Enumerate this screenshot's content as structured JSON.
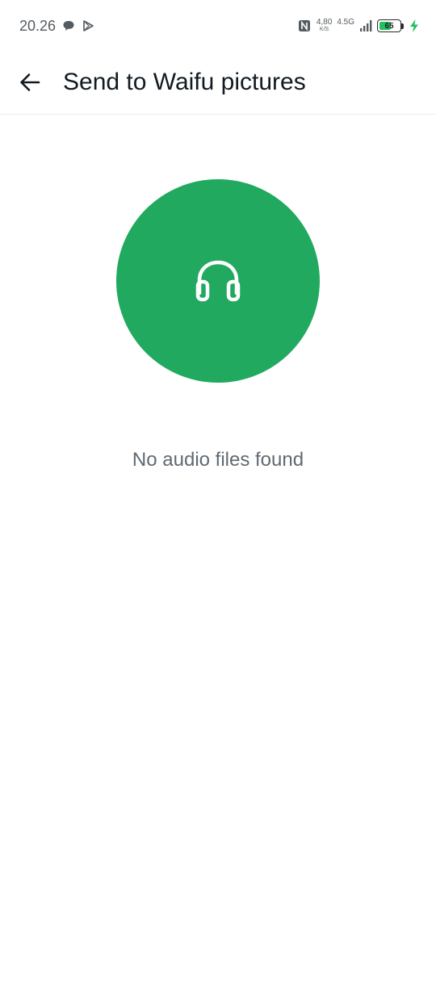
{
  "status_bar": {
    "time": "20.26",
    "left_icons": [
      "message-bubble-icon",
      "play-store-icon"
    ],
    "network_speed_value": "4,80",
    "network_speed_unit": "K/S",
    "network_type": "4.5G",
    "battery_level": "65",
    "battery_percent": 65,
    "charging": true
  },
  "app_bar": {
    "back_icon": "arrow-left-icon",
    "title": "Send to Waifu pictures"
  },
  "empty_state": {
    "icon": "headphones-icon",
    "message": "No audio files found"
  },
  "colors": {
    "accent": "#21a95f",
    "battery_fill": "#22c15e",
    "title_text": "#111b21",
    "secondary_text": "#5f6a72"
  }
}
